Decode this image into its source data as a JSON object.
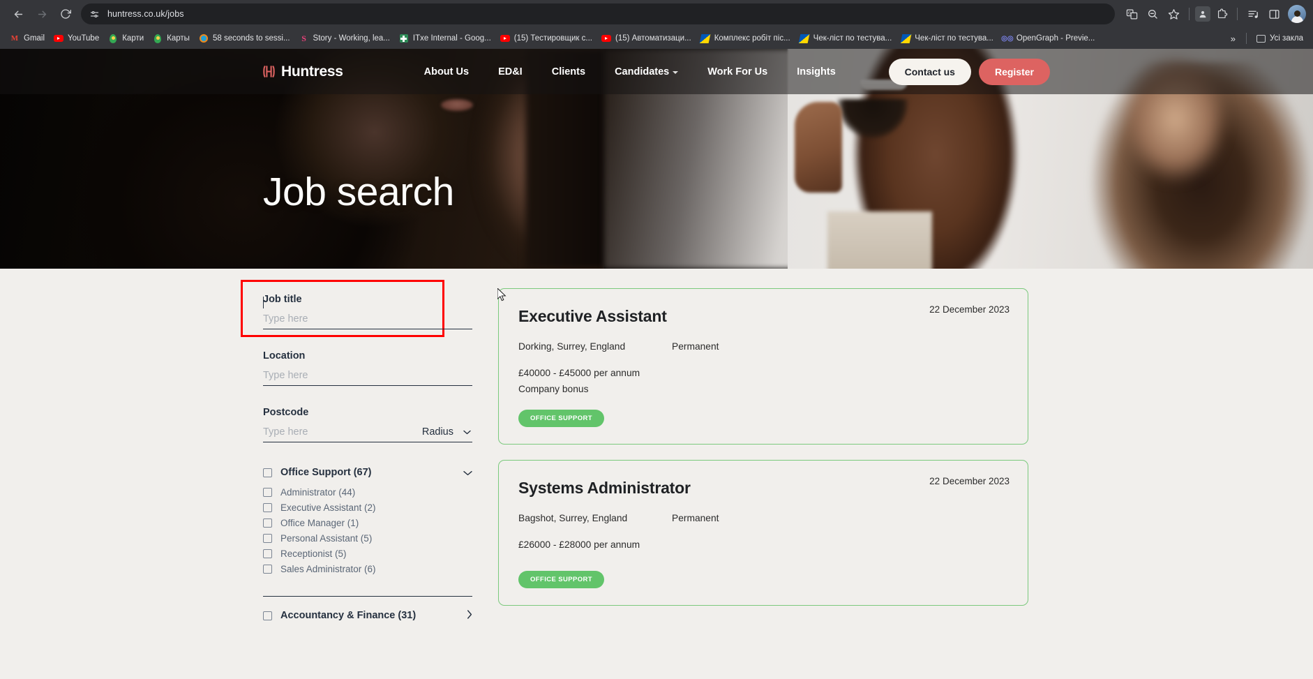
{
  "browser": {
    "url": "huntress.co.uk/jobs",
    "nav": {
      "back_icon": "back-arrow-icon",
      "forward_icon": "forward-arrow-icon",
      "reload_icon": "reload-icon",
      "site_info_icon": "site-settings-icon"
    },
    "toolbar_icons": [
      "translate-icon",
      "zoom-out-icon",
      "bookmark-star-icon",
      "profile-card-icon",
      "extensions-puzzle-icon",
      "reading-list-icon",
      "side-panel-icon",
      "account-avatar-icon"
    ],
    "bookmarks": [
      {
        "label": "Gmail",
        "icon": "gmail-icon"
      },
      {
        "label": "YouTube",
        "icon": "youtube-icon"
      },
      {
        "label": "Карти",
        "icon": "maps-pin-icon"
      },
      {
        "label": "Карты",
        "icon": "maps-pin-icon"
      },
      {
        "label": "58 seconds to sessi...",
        "icon": "ring-icon"
      },
      {
        "label": "Story - Working, lea...",
        "icon": "story-s-icon"
      },
      {
        "label": "ITxe Internal - Goog...",
        "icon": "green-cross-icon"
      },
      {
        "label": "(15) Тестировщик с...",
        "icon": "youtube-icon"
      },
      {
        "label": "(15) Автоматизаци...",
        "icon": "youtube-icon"
      },
      {
        "label": "Комплекс робіт піс...",
        "icon": "ua-flag-icon"
      },
      {
        "label": "Чек-ліст по тестува...",
        "icon": "ua-flag-icon"
      },
      {
        "label": "Чек-ліст по тестува...",
        "icon": "ua-flag-icon"
      },
      {
        "label": "OpenGraph - Previe...",
        "icon": "opengraph-icon"
      }
    ],
    "bookmarks_overflow": "»",
    "all_bookmarks_label": "Усі закла",
    "all_bookmarks_icon": "folder-icon"
  },
  "site": {
    "brand": {
      "name": "Huntress",
      "mark_icon": "huntress-logo-icon",
      "color": "#dd6361"
    },
    "nav_links": [
      {
        "label": "About Us",
        "has_dropdown": false
      },
      {
        "label": "ED&I",
        "has_dropdown": false
      },
      {
        "label": "Clients",
        "has_dropdown": false
      },
      {
        "label": "Candidates",
        "has_dropdown": true
      },
      {
        "label": "Work For Us",
        "has_dropdown": false
      },
      {
        "label": "Insights",
        "has_dropdown": false
      }
    ],
    "contact_label": "Contact us",
    "register_label": "Register",
    "hero_title": "Job search"
  },
  "search_form": {
    "job_title": {
      "label": "Job title",
      "placeholder": "Type here",
      "value": "",
      "focused": true
    },
    "location": {
      "label": "Location",
      "placeholder": "Type here",
      "value": ""
    },
    "postcode": {
      "label": "Postcode",
      "placeholder": "Type here",
      "value": "",
      "radius_label": "Radius",
      "radius_icon": "chevron-down-icon"
    }
  },
  "filters": [
    {
      "label": "Office Support (67)",
      "expanded": true,
      "toggle_icon": "chevron-down-icon",
      "children": [
        {
          "label": "Administrator (44)"
        },
        {
          "label": "Executive Assistant (2)"
        },
        {
          "label": "Office Manager (1)"
        },
        {
          "label": "Personal Assistant (5)"
        },
        {
          "label": "Receptionist (5)"
        },
        {
          "label": "Sales Administrator (6)"
        }
      ]
    },
    {
      "label": "Accountancy & Finance (31)",
      "expanded": false,
      "toggle_icon": "chevron-right-icon",
      "children": []
    }
  ],
  "jobs": [
    {
      "title": "Executive Assistant",
      "date": "22 December 2023",
      "location": "Dorking, Surrey, England",
      "type": "Permanent",
      "salary": "£40000 - £45000 per annum",
      "bonus": "Company bonus",
      "tag": "OFFICE SUPPORT"
    },
    {
      "title": "Systems Administrator",
      "date": "22 December 2023",
      "location": "Bagshot, Surrey, England",
      "type": "Permanent",
      "salary": "£26000 - £28000 per annum",
      "bonus": "",
      "tag": "OFFICE SUPPORT"
    }
  ],
  "colors": {
    "brand_red": "#dd6361",
    "page_bg": "#f1efec",
    "card_border": "#7bc97d",
    "tag_green": "#62c46a",
    "text_dark": "#25303f",
    "highlight_red": "#ff0000"
  }
}
